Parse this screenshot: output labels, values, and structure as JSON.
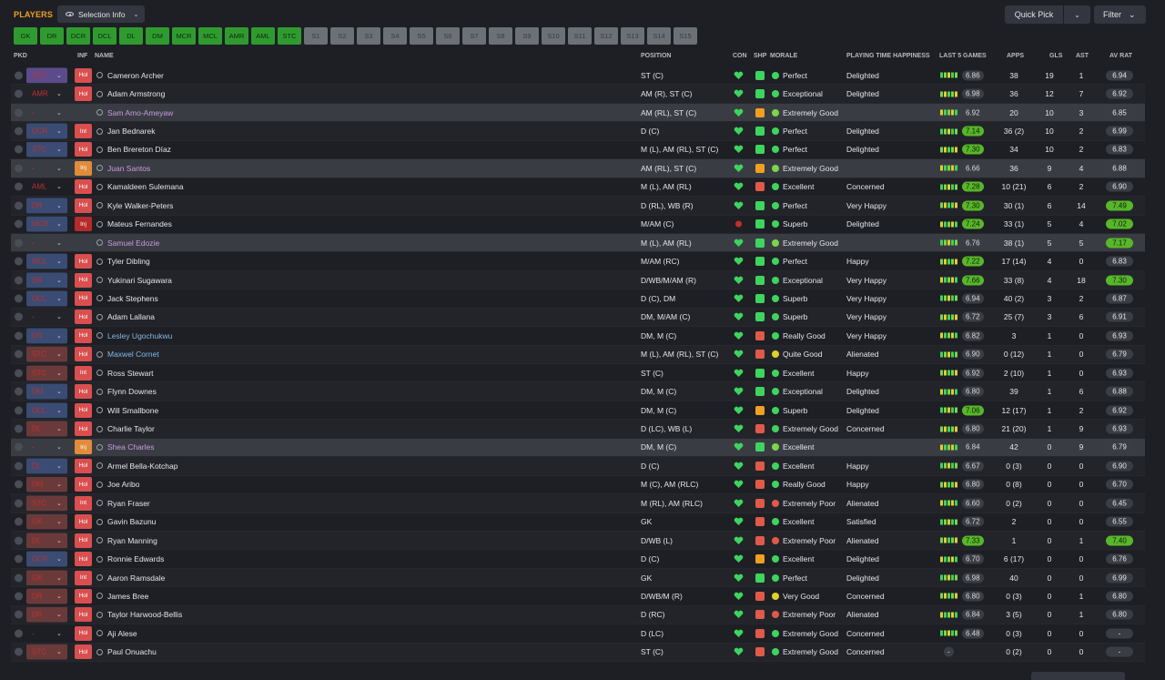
{
  "header": {
    "title": "PLAYERS",
    "selection_info": "Selection Info",
    "quick_pick": "Quick Pick",
    "filter": "Filter"
  },
  "tabs": [
    {
      "label": "GK",
      "active": true
    },
    {
      "label": "DR",
      "active": true
    },
    {
      "label": "DCR",
      "active": true
    },
    {
      "label": "DCL",
      "active": true
    },
    {
      "label": "DL",
      "active": true
    },
    {
      "label": "DM",
      "active": true
    },
    {
      "label": "MCR",
      "active": true
    },
    {
      "label": "MCL",
      "active": true
    },
    {
      "label": "AMR",
      "active": true
    },
    {
      "label": "AML",
      "active": true
    },
    {
      "label": "STC",
      "active": true
    },
    {
      "label": "S1",
      "active": false
    },
    {
      "label": "S2",
      "active": false
    },
    {
      "label": "S3",
      "active": false
    },
    {
      "label": "S4",
      "active": false
    },
    {
      "label": "S5",
      "active": false
    },
    {
      "label": "S6",
      "active": false
    },
    {
      "label": "S7",
      "active": false
    },
    {
      "label": "S8",
      "active": false
    },
    {
      "label": "S9",
      "active": false
    },
    {
      "label": "S10",
      "active": false
    },
    {
      "label": "S11",
      "active": false
    },
    {
      "label": "S12",
      "active": false
    },
    {
      "label": "S13",
      "active": false
    },
    {
      "label": "S14",
      "active": false
    },
    {
      "label": "S15",
      "active": false
    }
  ],
  "columns": {
    "pkd": "PKD",
    "inf": "INF",
    "name": "NAME",
    "position": "POSITION",
    "con": "CON",
    "shp": "SHP",
    "morale": "MORALE",
    "pth": "PLAYING TIME HAPPINESS",
    "last5": "LAST 5 GAMES",
    "apps": "APPS",
    "gls": "GLS",
    "ast": "AST",
    "avrat": "AV RAT"
  },
  "players": [
    {
      "sel": "STC",
      "selc": "pur",
      "inf": "Hol",
      "name": "Cameron Archer",
      "nc": "",
      "pos": "ST (C)",
      "shp": "g",
      "mor": "Perfect",
      "mc": "g",
      "pth": "Delighted",
      "l5": "6.86",
      "l5h": false,
      "apps": "38",
      "gls": "19",
      "ast": "1",
      "av": "6.94",
      "avh": false
    },
    {
      "sel": "AMR",
      "selc": "dash",
      "inf": "Hol",
      "name": "Adam Armstrong",
      "nc": "",
      "pos": "AM (R), ST (C)",
      "shp": "g",
      "mor": "Exceptional",
      "mc": "g",
      "pth": "Delighted",
      "l5": "6.98",
      "l5h": false,
      "apps": "36",
      "gls": "12",
      "ast": "7",
      "av": "6.92",
      "avh": false
    },
    {
      "sel": "-",
      "selc": "dash",
      "inf": "",
      "name": "Sam Amo-Ameyaw",
      "nc": "pink",
      "pos": "AM (RL), ST (C)",
      "shp": "o",
      "mor": "Extremely Good",
      "mc": "lg",
      "pth": "",
      "l5": "6.92",
      "l5h": false,
      "apps": "20",
      "gls": "10",
      "ast": "3",
      "av": "6.85",
      "avh": false,
      "hl": true
    },
    {
      "sel": "DCR",
      "selc": "",
      "inf": "Int",
      "name": "Jan Bednarek",
      "nc": "",
      "pos": "D (C)",
      "shp": "g",
      "mor": "Perfect",
      "mc": "g",
      "pth": "Delighted",
      "l5": "7.14",
      "l5h": true,
      "apps": "36 (2)",
      "gls": "10",
      "ast": "2",
      "av": "6.99",
      "avh": false
    },
    {
      "sel": "STC",
      "selc": "",
      "inf": "Hol",
      "name": "Ben Brereton Díaz",
      "nc": "",
      "pos": "M (L), AM (RL), ST (C)",
      "shp": "g",
      "mor": "Perfect",
      "mc": "g",
      "pth": "Delighted",
      "l5": "7.30",
      "l5h": true,
      "apps": "34",
      "gls": "10",
      "ast": "2",
      "av": "6.83",
      "avh": false
    },
    {
      "sel": "-",
      "selc": "dash",
      "inf": "Inj",
      "name": "Juan Santos",
      "nc": "pink",
      "pos": "AM (RL), ST (C)",
      "shp": "o",
      "mor": "Extremely Good",
      "mc": "lg",
      "pth": "",
      "l5": "6.66",
      "l5h": false,
      "apps": "36",
      "gls": "9",
      "ast": "4",
      "av": "6.88",
      "avh": false,
      "hl": true
    },
    {
      "sel": "AML",
      "selc": "dash",
      "inf": "Hol",
      "name": "Kamaldeen Sulemana",
      "nc": "",
      "pos": "M (L), AM (RL)",
      "shp": "r",
      "mor": "Excellent",
      "mc": "g",
      "pth": "Concerned",
      "l5": "7.28",
      "l5h": true,
      "apps": "10 (21)",
      "gls": "6",
      "ast": "2",
      "av": "6.90",
      "avh": false
    },
    {
      "sel": "DR",
      "selc": "",
      "inf": "Hol",
      "name": "Kyle Walker-Peters",
      "nc": "",
      "pos": "D (RL), WB (R)",
      "shp": "g",
      "mor": "Perfect",
      "mc": "g",
      "pth": "Very Happy",
      "l5": "7.30",
      "l5h": true,
      "apps": "30 (1)",
      "gls": "6",
      "ast": "14",
      "av": "7.49",
      "avh": true
    },
    {
      "sel": "MCR",
      "selc": "",
      "inf": "Inj2",
      "name": "Mateus Fernandes",
      "nc": "",
      "pos": "M/AM (C)",
      "shp": "g",
      "mor": "Superb",
      "mc": "g",
      "pth": "Delighted",
      "l5": "7.24",
      "l5h": true,
      "apps": "33 (1)",
      "gls": "5",
      "ast": "4",
      "av": "7.02",
      "avh": true,
      "conr": true
    },
    {
      "sel": "-",
      "selc": "dash",
      "inf": "",
      "name": "Samuel Edozie",
      "nc": "pink",
      "pos": "M (L), AM (RL)",
      "shp": "g",
      "mor": "Extremely Good",
      "mc": "lg",
      "pth": "",
      "l5": "6.76",
      "l5h": false,
      "apps": "38 (1)",
      "gls": "5",
      "ast": "5",
      "av": "7.17",
      "avh": true,
      "hl": true
    },
    {
      "sel": "MCL",
      "selc": "",
      "inf": "Hol",
      "name": "Tyler Dibling",
      "nc": "",
      "pos": "M/AM (RC)",
      "shp": "g",
      "mor": "Perfect",
      "mc": "g",
      "pth": "Happy",
      "l5": "7.22",
      "l5h": true,
      "apps": "17 (14)",
      "gls": "4",
      "ast": "0",
      "av": "6.83",
      "avh": false
    },
    {
      "sel": "DR",
      "selc": "",
      "inf": "Hol",
      "name": "Yukinari Sugawara",
      "nc": "",
      "pos": "D/WB/M/AM (R)",
      "shp": "g",
      "mor": "Exceptional",
      "mc": "g",
      "pth": "Very Happy",
      "l5": "7.66",
      "l5h": true,
      "apps": "33 (8)",
      "gls": "4",
      "ast": "18",
      "av": "7.30",
      "avh": true
    },
    {
      "sel": "DCL",
      "selc": "",
      "inf": "Hol",
      "name": "Jack Stephens",
      "nc": "",
      "pos": "D (C), DM",
      "shp": "g",
      "mor": "Superb",
      "mc": "g",
      "pth": "Very Happy",
      "l5": "6.94",
      "l5h": false,
      "apps": "40 (2)",
      "gls": "3",
      "ast": "2",
      "av": "6.87",
      "avh": false
    },
    {
      "sel": "-",
      "selc": "dash",
      "inf": "Hol",
      "name": "Adam Lallana",
      "nc": "",
      "pos": "DM, M/AM (C)",
      "shp": "g",
      "mor": "Superb",
      "mc": "g",
      "pth": "Very Happy",
      "l5": "6.72",
      "l5h": false,
      "apps": "25 (7)",
      "gls": "3",
      "ast": "6",
      "av": "6.91",
      "avh": false
    },
    {
      "sel": "DR",
      "selc": "",
      "inf": "Hol",
      "name": "Lesley Ugochukwu",
      "nc": "blue",
      "pos": "DM, M (C)",
      "shp": "r",
      "mor": "Really Good",
      "mc": "g",
      "pth": "Very Happy",
      "l5": "6.82",
      "l5h": false,
      "apps": "3",
      "gls": "1",
      "ast": "0",
      "av": "6.93",
      "avh": false
    },
    {
      "sel": "STC",
      "selc": "red",
      "inf": "Hol",
      "name": "Maxwel Cornet",
      "nc": "blue",
      "pos": "M (L), AM (RL), ST (C)",
      "shp": "r",
      "mor": "Quite Good",
      "mc": "y",
      "pth": "Alienated",
      "l5": "6.90",
      "l5h": false,
      "apps": "0 (12)",
      "gls": "1",
      "ast": "0",
      "av": "6.79",
      "avh": false
    },
    {
      "sel": "STC",
      "selc": "red",
      "inf": "Int",
      "name": "Ross Stewart",
      "nc": "",
      "pos": "ST (C)",
      "shp": "g",
      "mor": "Excellent",
      "mc": "g",
      "pth": "Happy",
      "l5": "6.92",
      "l5h": false,
      "apps": "2 (10)",
      "gls": "1",
      "ast": "0",
      "av": "6.93",
      "avh": false
    },
    {
      "sel": "DM",
      "selc": "",
      "inf": "Hol",
      "name": "Flynn Downes",
      "nc": "",
      "pos": "DM, M (C)",
      "shp": "g",
      "mor": "Exceptional",
      "mc": "g",
      "pth": "Delighted",
      "l5": "6.80",
      "l5h": false,
      "apps": "39",
      "gls": "1",
      "ast": "6",
      "av": "6.88",
      "avh": false
    },
    {
      "sel": "DCL",
      "selc": "",
      "inf": "Hol",
      "name": "Will Smallbone",
      "nc": "",
      "pos": "DM, M (C)",
      "shp": "o",
      "mor": "Superb",
      "mc": "g",
      "pth": "Delighted",
      "l5": "7.06",
      "l5h": true,
      "apps": "12 (17)",
      "gls": "1",
      "ast": "2",
      "av": "6.92",
      "avh": false
    },
    {
      "sel": "DL",
      "selc": "red",
      "inf": "Hol",
      "name": "Charlie Taylor",
      "nc": "",
      "pos": "D (LC), WB (L)",
      "shp": "r",
      "mor": "Extremely Good",
      "mc": "g",
      "pth": "Concerned",
      "l5": "6.80",
      "l5h": false,
      "apps": "21 (20)",
      "gls": "1",
      "ast": "9",
      "av": "6.93",
      "avh": false
    },
    {
      "sel": "-",
      "selc": "dash",
      "inf": "Inj",
      "name": "Shea Charles",
      "nc": "pink",
      "pos": "DM, M (C)",
      "shp": "g",
      "mor": "Excellent",
      "mc": "lg",
      "pth": "",
      "l5": "6.84",
      "l5h": false,
      "apps": "42",
      "gls": "0",
      "ast": "9",
      "av": "6.79",
      "avh": false,
      "hl": true
    },
    {
      "sel": "DL",
      "selc": "",
      "inf": "Hol",
      "name": "Armel Bella-Kotchap",
      "nc": "",
      "pos": "D (C)",
      "shp": "r",
      "mor": "Excellent",
      "mc": "g",
      "pth": "Happy",
      "l5": "6.67",
      "l5h": false,
      "apps": "0 (3)",
      "gls": "0",
      "ast": "0",
      "av": "6.90",
      "avh": false
    },
    {
      "sel": "DM",
      "selc": "red",
      "inf": "Hol",
      "name": "Joe Aribo",
      "nc": "",
      "pos": "M (C), AM (RLC)",
      "shp": "r",
      "mor": "Really Good",
      "mc": "g",
      "pth": "Happy",
      "l5": "6.80",
      "l5h": false,
      "apps": "0 (8)",
      "gls": "0",
      "ast": "0",
      "av": "6.70",
      "avh": false
    },
    {
      "sel": "STC",
      "selc": "red",
      "inf": "Int",
      "name": "Ryan Fraser",
      "nc": "",
      "pos": "M (RL), AM (RLC)",
      "shp": "r",
      "mor": "Extremely Poor",
      "mc": "r",
      "pth": "Alienated",
      "l5": "6.60",
      "l5h": false,
      "apps": "0 (2)",
      "gls": "0",
      "ast": "0",
      "av": "6.45",
      "avh": false
    },
    {
      "sel": "GK",
      "selc": "red",
      "inf": "Hol",
      "name": "Gavin Bazunu",
      "nc": "",
      "pos": "GK",
      "shp": "r",
      "mor": "Excellent",
      "mc": "g",
      "pth": "Satisfied",
      "l5": "6.72",
      "l5h": false,
      "apps": "2",
      "gls": "0",
      "ast": "0",
      "av": "6.55",
      "avh": false
    },
    {
      "sel": "DL",
      "selc": "red",
      "inf": "Hol",
      "name": "Ryan Manning",
      "nc": "",
      "pos": "D/WB (L)",
      "shp": "r",
      "mor": "Extremely Poor",
      "mc": "r",
      "pth": "Alienated",
      "l5": "7.33",
      "l5h": true,
      "apps": "1",
      "gls": "0",
      "ast": "1",
      "av": "7.40",
      "avh": true
    },
    {
      "sel": "DCR",
      "selc": "",
      "inf": "Hol",
      "name": "Ronnie Edwards",
      "nc": "",
      "pos": "D (C)",
      "shp": "o",
      "mor": "Excellent",
      "mc": "g",
      "pth": "Delighted",
      "l5": "6.70",
      "l5h": false,
      "apps": "6 (17)",
      "gls": "0",
      "ast": "0",
      "av": "6.76",
      "avh": false
    },
    {
      "sel": "GK",
      "selc": "red",
      "inf": "Int",
      "name": "Aaron Ramsdale",
      "nc": "",
      "pos": "GK",
      "shp": "g",
      "mor": "Perfect",
      "mc": "g",
      "pth": "Delighted",
      "l5": "6.98",
      "l5h": false,
      "apps": "40",
      "gls": "0",
      "ast": "0",
      "av": "6.99",
      "avh": false
    },
    {
      "sel": "DR",
      "selc": "red",
      "inf": "Hol",
      "name": "James Bree",
      "nc": "",
      "pos": "D/WB/M (R)",
      "shp": "r",
      "mor": "Very Good",
      "mc": "y",
      "pth": "Concerned",
      "l5": "6.80",
      "l5h": false,
      "apps": "0 (3)",
      "gls": "0",
      "ast": "1",
      "av": "6.80",
      "avh": false
    },
    {
      "sel": "DR",
      "selc": "red",
      "inf": "Hol",
      "name": "Taylor Harwood-Bellis",
      "nc": "",
      "pos": "D (RC)",
      "shp": "r",
      "mor": "Extremely Poor",
      "mc": "r",
      "pth": "Alienated",
      "l5": "6.84",
      "l5h": false,
      "apps": "3 (5)",
      "gls": "0",
      "ast": "1",
      "av": "6.80",
      "avh": false
    },
    {
      "sel": "-",
      "selc": "dash",
      "inf": "Hol",
      "name": "Aji Alese",
      "nc": "",
      "pos": "D (LC)",
      "shp": "r",
      "mor": "Extremely Good",
      "mc": "g",
      "pth": "Concerned",
      "l5": "6.48",
      "l5h": false,
      "apps": "0 (3)",
      "gls": "0",
      "ast": "0",
      "av": "-",
      "avh": false
    },
    {
      "sel": "STC",
      "selc": "red",
      "inf": "Hol",
      "name": "Paul Onuachu",
      "nc": "",
      "pos": "ST (C)",
      "shp": "r",
      "mor": "Extremely Good",
      "mc": "g",
      "pth": "Concerned",
      "l5": "-",
      "l5h": false,
      "apps": "0 (2)",
      "gls": "0",
      "ast": "0",
      "av": "-",
      "avh": false
    }
  ]
}
